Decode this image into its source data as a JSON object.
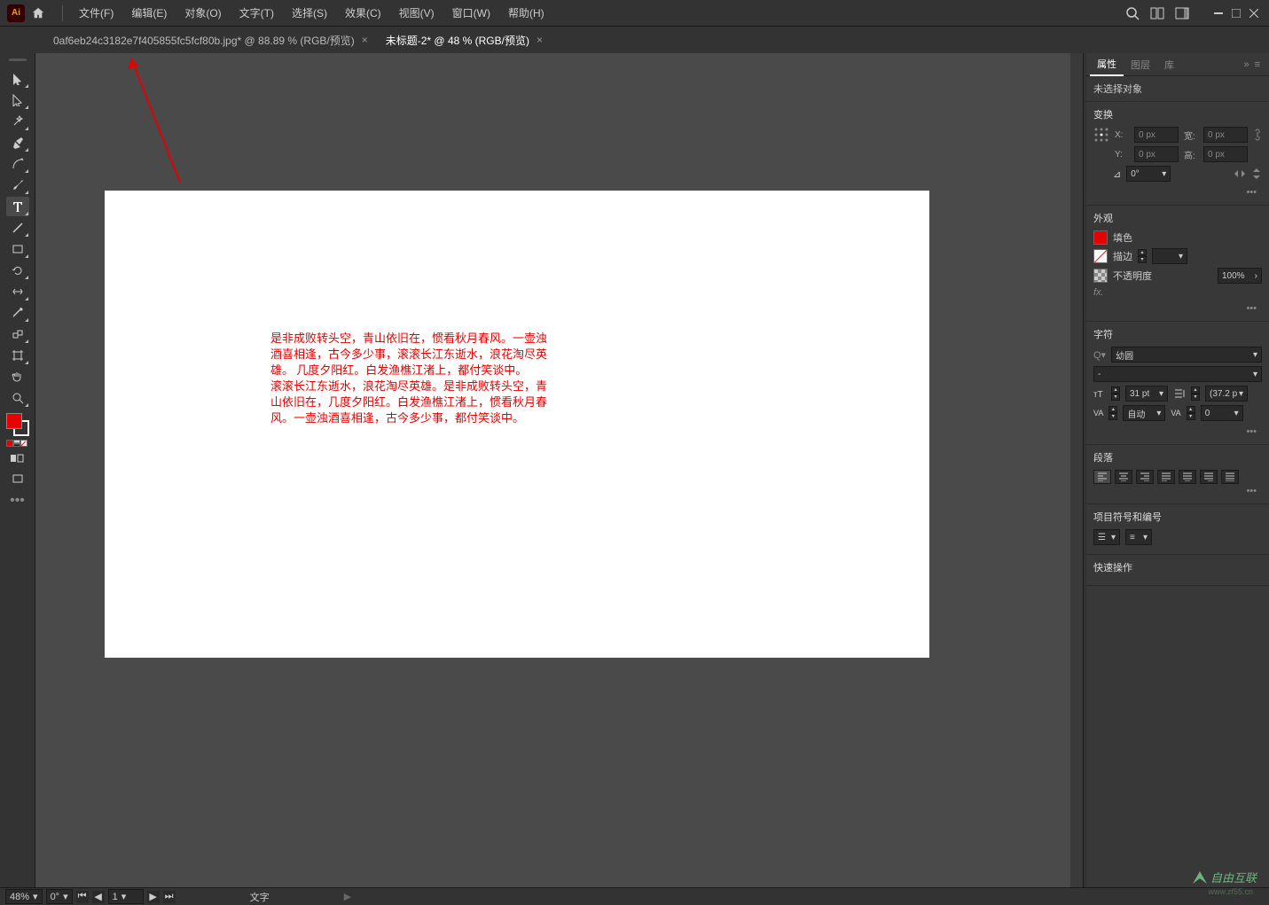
{
  "menu": {
    "items": [
      "文件(F)",
      "编辑(E)",
      "对象(O)",
      "文字(T)",
      "选择(S)",
      "效果(C)",
      "视图(V)",
      "窗口(W)",
      "帮助(H)"
    ]
  },
  "tabs": [
    {
      "label": "0af6eb24c3182e7f405855fc5fcf80b.jpg* @ 88.89 % (RGB/预览)"
    },
    {
      "label": "未标题-2* @ 48 % (RGB/预览)"
    }
  ],
  "canvas_text": "是非成败转头空，青山依旧在，惯看秋月春风。一壶浊酒喜相逢，古今多少事，滚滚长江东逝水，浪花淘尽英雄。 几度夕阳红。白发渔樵江渚上，都付笑谈中。\n滚滚长江东逝水，浪花淘尽英雄。是非成败转头空，青山依旧在，几度夕阳红。白发渔樵江渚上，惯看秋月春风。一壶浊酒喜相逢，古今多少事，都付笑谈中。",
  "panel": {
    "tabs": [
      "属性",
      "图层",
      "库"
    ],
    "no_selection": "未选择对象",
    "transform": {
      "title": "变换",
      "x_label": "X:",
      "x_val": "0 px",
      "y_label": "Y:",
      "y_val": "0 px",
      "w_label": "宽:",
      "w_val": "0 px",
      "h_label": "高:",
      "h_val": "0 px",
      "angle": "0°"
    },
    "appearance": {
      "title": "外观",
      "fill": "填色",
      "stroke": "描边",
      "opacity_label": "不透明度",
      "opacity_val": "100%",
      "fx": "fx."
    },
    "char": {
      "title": "字符",
      "font": "幼圆",
      "style": "-",
      "size": "31 pt",
      "leading": "(37.2 p",
      "tracking_mode": "自动",
      "tracking_val": "0"
    },
    "paragraph": {
      "title": "段落"
    },
    "bullets": {
      "title": "项目符号和编号"
    },
    "quick": {
      "title": "快速操作"
    }
  },
  "status": {
    "zoom": "48%",
    "angle": "0°",
    "page": "1",
    "tool": "文字"
  },
  "watermark": "自由互联",
  "watermark_sub": "www.zf55.cn"
}
